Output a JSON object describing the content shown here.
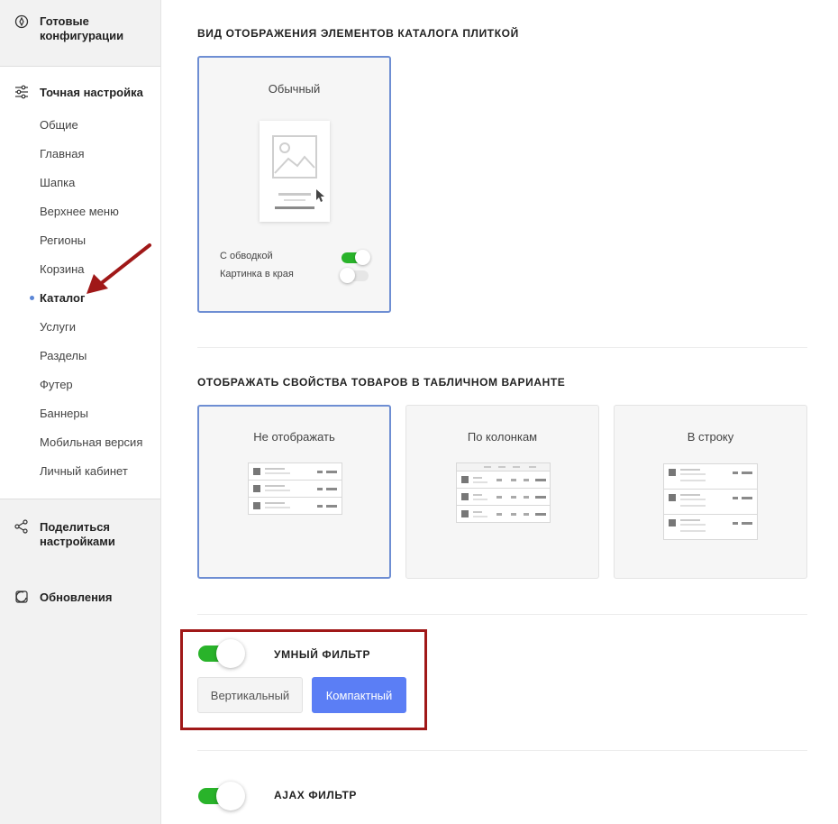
{
  "sidebar": {
    "ready_configs": "Готовые конфигурации",
    "fine_tuning": "Точная настройка",
    "items": [
      {
        "label": "Общие"
      },
      {
        "label": "Главная"
      },
      {
        "label": "Шапка"
      },
      {
        "label": "Верхнее меню"
      },
      {
        "label": "Регионы"
      },
      {
        "label": "Корзина"
      },
      {
        "label": "Каталог"
      },
      {
        "label": "Услуги"
      },
      {
        "label": "Разделы"
      },
      {
        "label": "Футер"
      },
      {
        "label": "Баннеры"
      },
      {
        "label": "Мобильная версия"
      },
      {
        "label": "Личный кабинет"
      }
    ],
    "active_item": "Каталог",
    "share": "Поделиться настройками",
    "updates": "Обновления"
  },
  "tile_section": {
    "title": "ВИД ОТОБРАЖЕНИЯ ЭЛЕМЕНТОВ КАТАЛОГА ПЛИТКОЙ",
    "card_label": "Обычный",
    "option_border": "С обводкой",
    "option_border_on": true,
    "option_edge_image": "Картинка в края",
    "option_edge_image_on": false
  },
  "table_section": {
    "title": "ОТОБРАЖАТЬ СВОЙСТВА ТОВАРОВ В ТАБЛИЧНОМ ВАРИАНТЕ",
    "options": [
      {
        "label": "Не отображать",
        "selected": true
      },
      {
        "label": "По колонкам",
        "selected": false
      },
      {
        "label": "В строку",
        "selected": false
      }
    ]
  },
  "smart_filter": {
    "title": "УМНЫЙ ФИЛЬТР",
    "enabled": true,
    "vertical_label": "Вертикальный",
    "compact_label": "Компактный",
    "selected": "Компактный"
  },
  "ajax_filter": {
    "title": "AJAX ФИЛЬТР",
    "enabled": true
  },
  "colors": {
    "accent_blue": "#5b7ef5",
    "toggle_green": "#29b32a",
    "selection_border": "#6e8ed3",
    "annotation_red": "#a01818"
  }
}
